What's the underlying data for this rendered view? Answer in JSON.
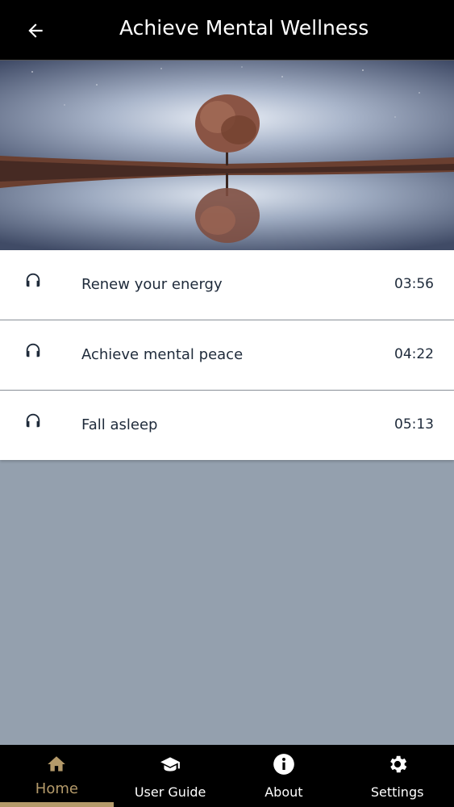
{
  "header": {
    "title": "Achieve Mental Wellness",
    "back_icon": "arrow-left-icon"
  },
  "hero": {
    "image": "tree-reflection-lake-night-sky"
  },
  "tracks": [
    {
      "label": "Renew your energy",
      "duration": "03:56",
      "icon": "headphones-icon"
    },
    {
      "label": "Achieve mental peace",
      "duration": "04:22",
      "icon": "headphones-icon"
    },
    {
      "label": "Fall asleep",
      "duration": "05:13",
      "icon": "headphones-icon"
    }
  ],
  "nav": {
    "items": [
      {
        "label": "Home",
        "icon": "home-icon",
        "active": true
      },
      {
        "label": "User Guide",
        "icon": "graduation-cap-icon",
        "active": false
      },
      {
        "label": "About",
        "icon": "info-icon",
        "active": false
      },
      {
        "label": "Settings",
        "icon": "gear-icon",
        "active": false
      }
    ]
  },
  "colors": {
    "accent": "#b49a6a",
    "background": "#94a0ae",
    "bar": "#000000"
  }
}
